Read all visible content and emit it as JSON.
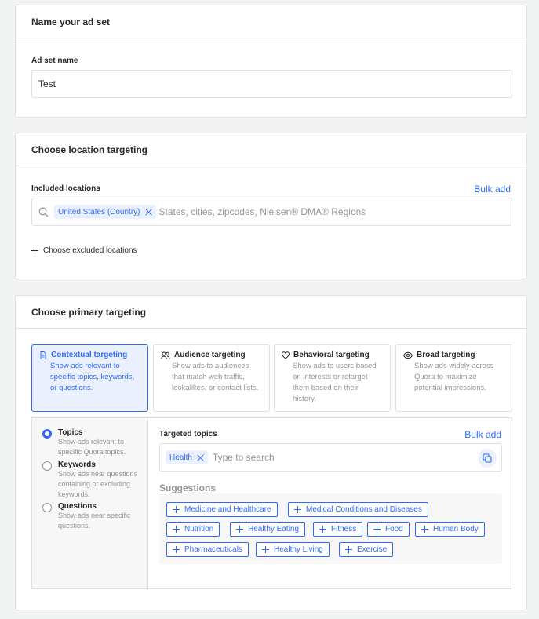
{
  "adset": {
    "header": "Name your ad set",
    "name_label": "Ad set name",
    "name_value": "Test"
  },
  "location": {
    "header": "Choose location targeting",
    "included_label": "Included locations",
    "bulk_add": "Bulk add",
    "chip": "United States (Country)",
    "placeholder": "States, cities, zipcodes, Nielsen® DMA® Regions",
    "excluded": "Choose excluded locations"
  },
  "primary": {
    "header": "Choose primary targeting",
    "types": [
      {
        "title": "Contextual targeting",
        "desc": "Show ads relevant to specific topics, keywords, or questions.",
        "icon": "document-icon",
        "selected": true
      },
      {
        "title": "Audience targeting",
        "desc": "Show ads to audiences that match web traffic, lookalikes, or contact lists.",
        "icon": "people-icon",
        "selected": false
      },
      {
        "title": "Behavioral targeting",
        "desc": "Show ads to users based on interests or retarget them based on their history.",
        "icon": "heart-icon",
        "selected": false
      },
      {
        "title": "Broad targeting",
        "desc": "Show ads widely across Quora to maximize potential impressions.",
        "icon": "eye-icon",
        "selected": false
      }
    ],
    "options": [
      {
        "label": "Topics",
        "desc": "Show ads relevant to specific Quora topics.",
        "selected": true
      },
      {
        "label": "Keywords",
        "desc": "Show ads near questions containing or excluding keywords.",
        "selected": false
      },
      {
        "label": "Questions",
        "desc": "Show ads near specific questions.",
        "selected": false
      }
    ],
    "topics_label": "Targeted topics",
    "bulk_add": "Bulk add",
    "topic_chip": "Health",
    "topics_placeholder": "Type to search",
    "suggestions_label": "Suggestions",
    "suggestions": [
      "Medicine and Healthcare",
      "Medical Conditions and Diseases",
      "Nutrition",
      "Healthy Eating",
      "Fitness",
      "Food",
      "Human Body",
      "Pharmaceuticals",
      "Healthy Living",
      "Exercise"
    ]
  },
  "colors": {
    "accent": "#2e69ff",
    "accent_bg": "#ebf0ff",
    "border": "#dee0e1",
    "muted": "#939598"
  }
}
